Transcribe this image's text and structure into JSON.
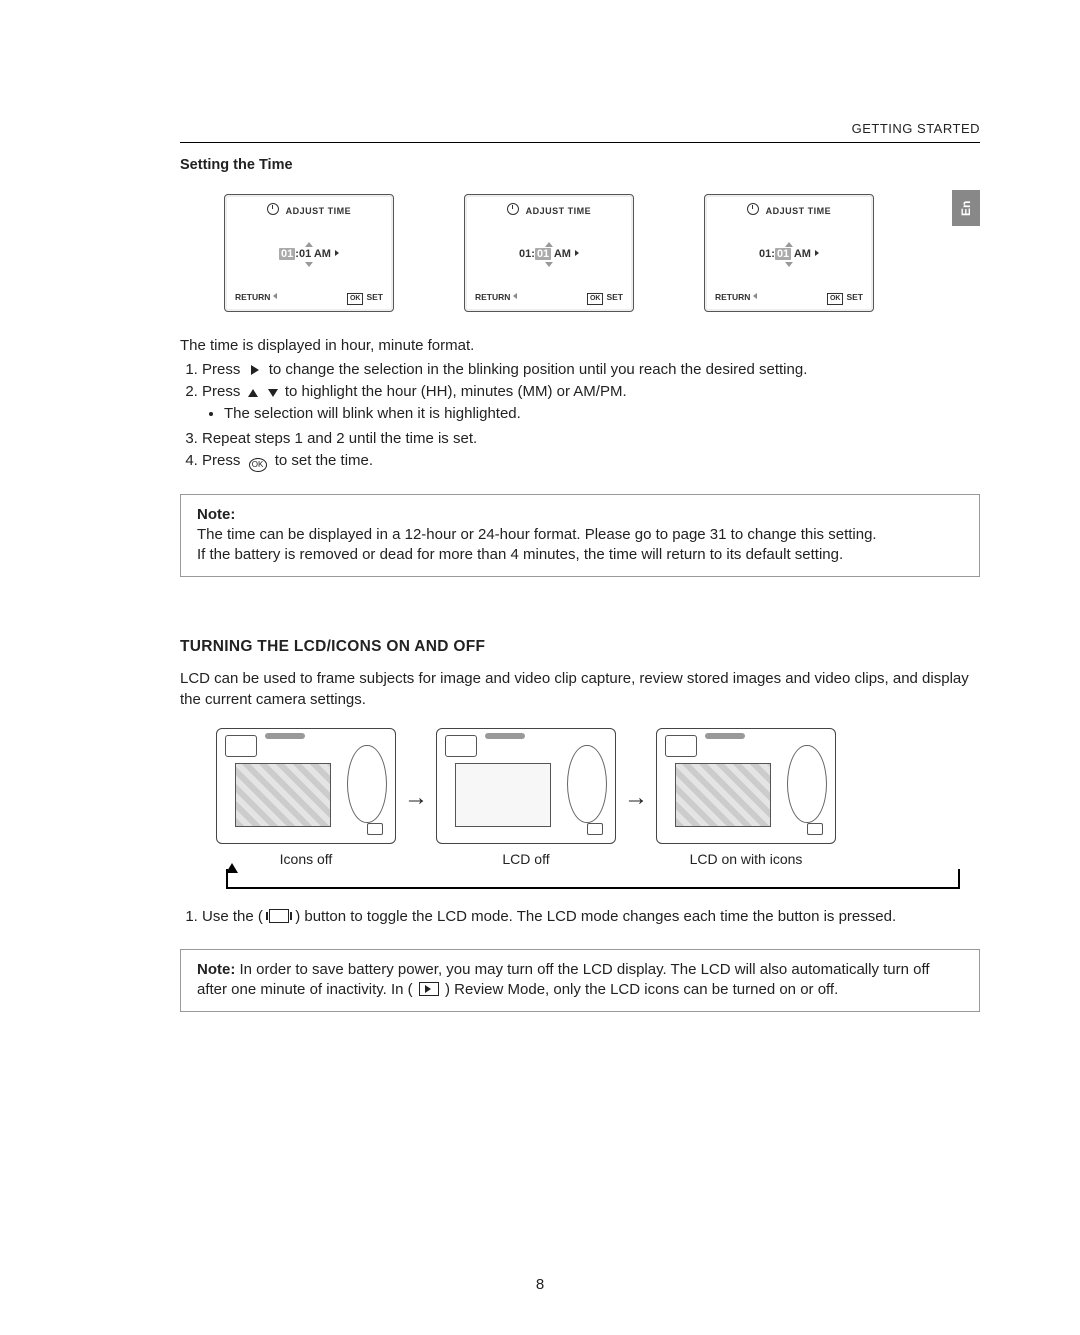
{
  "header": {
    "section": "GETTING STARTED",
    "lang_tab": "En"
  },
  "section1": {
    "title": "Setting the Time",
    "screens": {
      "title": "ADJUST TIME",
      "return": "RETURN",
      "set": "SET",
      "s1": {
        "hh": "01",
        "mm": ":01 AM"
      },
      "s2": {
        "pre": "01:",
        "mm": "01",
        "post": " AM"
      },
      "s3": {
        "pre": "01:",
        "mm": "01",
        "post": " AM"
      }
    },
    "intro": "The time is displayed in hour, minute format.",
    "step1a": "Press",
    "step1b": "to change the selection in the blinking position until you reach the desired setting.",
    "step2a": "Press",
    "step2b": "to highlight the hour (HH), minutes (MM) or AM/PM.",
    "step2sub": "The selection will blink when it is highlighted.",
    "step3": "Repeat steps 1 and 2 until the time is set.",
    "step4a": "Press",
    "step4b": "to set the time.",
    "ok_label": "OK"
  },
  "note1": {
    "heading": "Note:",
    "l1": "The time can be displayed in a 12-hour or 24-hour format. Please go to page 31 to change this setting.",
    "l2": "If the battery is removed or dead for more than 4 minutes, the time will return to its default setting."
  },
  "section2": {
    "heading": "TURNING THE LCD/ICONS ON AND OFF",
    "intro": "LCD can be used to frame subjects for image and video clip capture, review stored images and video clips, and display the current camera settings.",
    "labels": {
      "c1": "Icons off",
      "c2": "LCD off",
      "c3": "LCD on with icons"
    },
    "step1a": "Use the (",
    "step1b": ") button to toggle the LCD mode. The LCD mode changes each time the button is pressed."
  },
  "note2": {
    "heading": "Note:",
    "l1a": "In order to save battery power, you may turn off the LCD display. The LCD will also automatically turn off after one minute of inactivity.  In (",
    "l1b": ") Review Mode, only the LCD icons can be turned on or off."
  },
  "page_number": "8"
}
